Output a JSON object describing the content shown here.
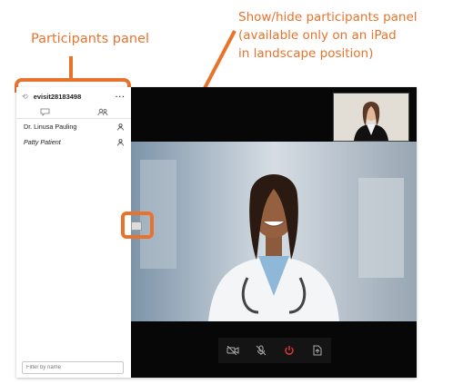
{
  "annotations": {
    "participants_panel": "Participants panel",
    "toggle_lines": [
      "Show/hide participants panel",
      "(available only on an iPad",
      "in landscape position)"
    ]
  },
  "panel": {
    "title": "evisit28183498",
    "participants": [
      {
        "name": "Dr. Linusa Pauling",
        "italic": false
      },
      {
        "name": "Patty Patient",
        "italic": true
      }
    ],
    "filter_placeholder": "Filter by name"
  },
  "colors": {
    "annotation": "#e8732c",
    "video_bg": "#070707",
    "end_call": "#e53935"
  },
  "controls": [
    "video-off-icon",
    "mic-off-icon",
    "end-call-icon",
    "share-icon"
  ]
}
